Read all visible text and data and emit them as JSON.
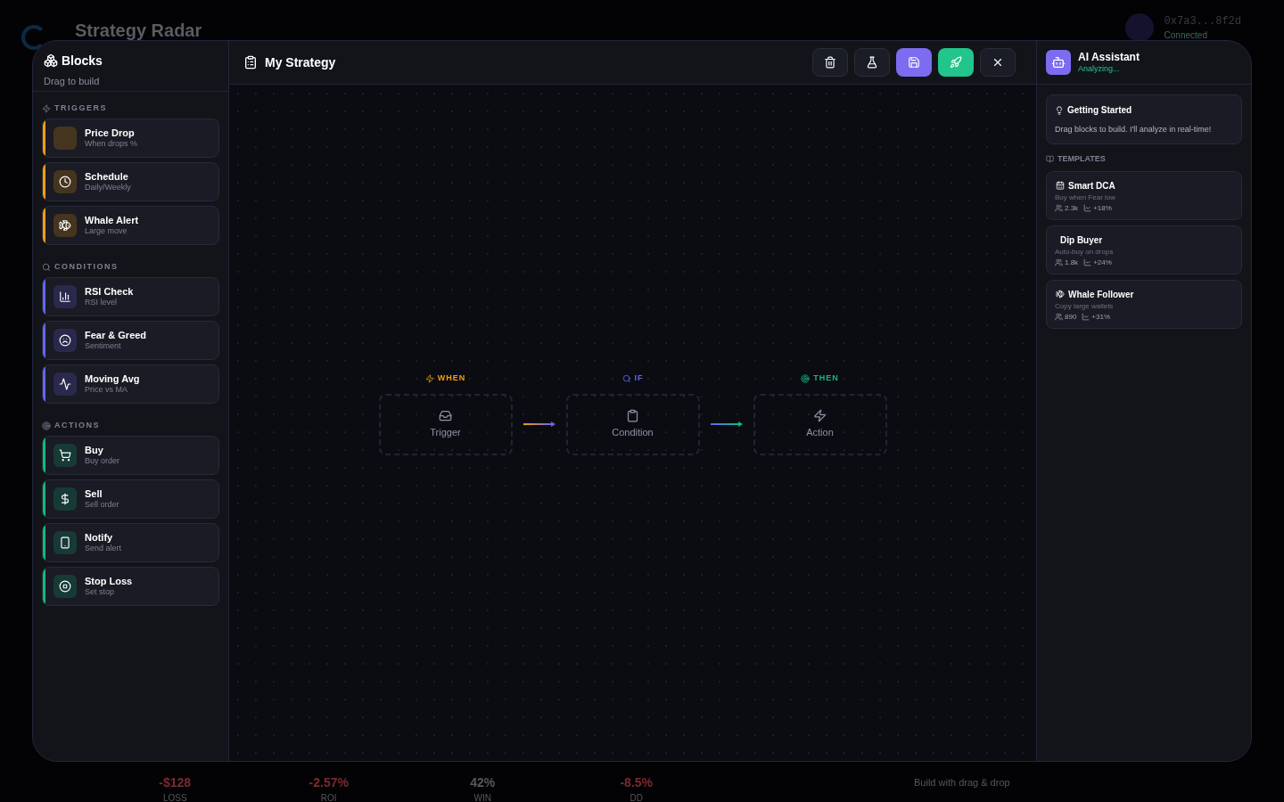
{
  "background": {
    "title": "Strategy Radar",
    "wallet": {
      "address": "0x7a3...8f2d",
      "status": "Connected"
    },
    "stats": [
      {
        "value": "-$128",
        "label": "LOSS",
        "color": "#7a2a30"
      },
      {
        "value": "-2.57%",
        "label": "ROI",
        "color": "#7a2a30"
      },
      {
        "value": "42%",
        "label": "WIN",
        "color": "#56585f"
      },
      {
        "value": "-8.5%",
        "label": "DD",
        "color": "#7a2a30"
      }
    ],
    "canvas_subtitle": "Build with drag & drop"
  },
  "blocks_panel": {
    "title": "Blocks",
    "subtitle": "Drag to build",
    "groups": [
      {
        "title": "TRIGGERS",
        "color": "#f59e0b",
        "items": [
          {
            "name": "Price Drop",
            "description": "When drops %"
          },
          {
            "name": "Schedule",
            "description": "Daily/Weekly"
          },
          {
            "name": "Whale Alert",
            "description": "Large move"
          }
        ]
      },
      {
        "title": "CONDITIONS",
        "color": "#6366f1",
        "items": [
          {
            "name": "RSI Check",
            "description": "RSI level"
          },
          {
            "name": "Fear & Greed",
            "description": "Sentiment"
          },
          {
            "name": "Moving Avg",
            "description": "Price vs MA"
          }
        ]
      },
      {
        "title": "ACTIONS",
        "color": "#10b981",
        "items": [
          {
            "name": "Buy",
            "description": "Buy order"
          },
          {
            "name": "Sell",
            "description": "Sell order"
          },
          {
            "name": "Notify",
            "description": "Send alert"
          },
          {
            "name": "Stop Loss",
            "description": "Set stop"
          }
        ]
      }
    ]
  },
  "canvas": {
    "title": "My Strategy",
    "toolbar": [
      {
        "kind": "delete"
      },
      {
        "kind": "test"
      },
      {
        "kind": "save"
      },
      {
        "kind": "deploy"
      },
      {
        "kind": "close"
      }
    ],
    "slots": [
      {
        "heading": "WHEN",
        "label": "Trigger",
        "color": "#f59e0b"
      },
      {
        "heading": "IF",
        "label": "Condition",
        "color": "#6366f1"
      },
      {
        "heading": "THEN",
        "label": "Action",
        "color": "#10b981"
      }
    ]
  },
  "assistant": {
    "title": "AI Assistant",
    "status": "Analyzing...",
    "tip": {
      "title": "Getting Started",
      "text": "Drag blocks to build. I'll analyze in real-time!"
    },
    "templates_heading": "TEMPLATES",
    "templates": [
      {
        "name": "Smart DCA",
        "description": "Buy when Fear low",
        "users": "2.3k",
        "return": "+18%"
      },
      {
        "name": "Dip Buyer",
        "description": "Auto-buy on drops",
        "users": "1.8k",
        "return": "+24%"
      },
      {
        "name": "Whale Follower",
        "description": "Copy large wallets",
        "users": "890",
        "return": "+31%"
      }
    ]
  }
}
